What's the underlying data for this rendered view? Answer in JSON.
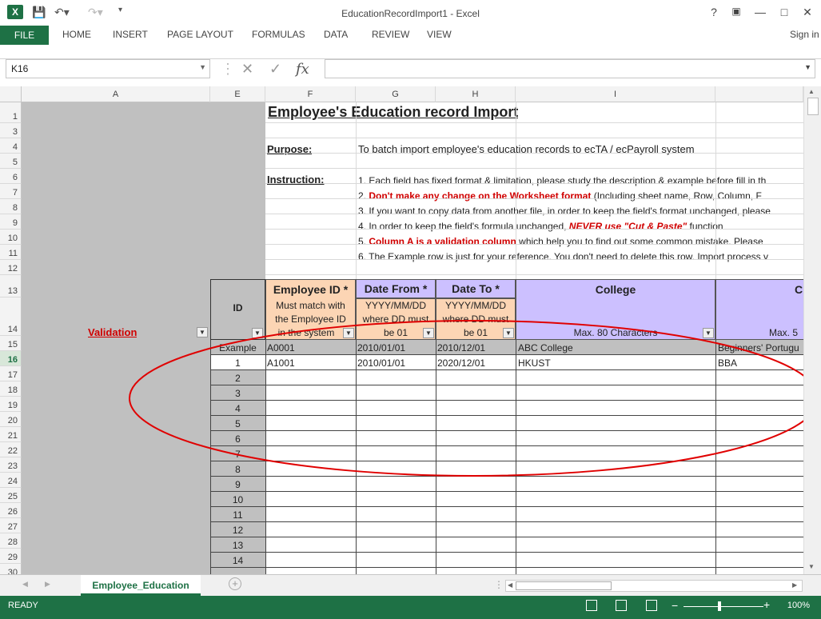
{
  "window": {
    "title": "EducationRecordImport1 - Excel",
    "help": "?",
    "signin": "Sign in"
  },
  "ribbon": {
    "tabs": [
      "FILE",
      "HOME",
      "INSERT",
      "PAGE LAYOUT",
      "FORMULAS",
      "DATA",
      "REVIEW",
      "VIEW"
    ]
  },
  "formula_bar": {
    "name_box": "K16",
    "fx": "fx",
    "formula": ""
  },
  "columns": [
    "A",
    "E",
    "F",
    "G",
    "H",
    "I"
  ],
  "cut_col_letter": "C",
  "rows": [
    "1",
    "3",
    "4",
    "5",
    "6",
    "7",
    "8",
    "9",
    "10",
    "11",
    "12",
    "13",
    "14",
    "15",
    "16",
    "17",
    "18",
    "19",
    "20",
    "21",
    "22",
    "23",
    "24",
    "25",
    "26",
    "27",
    "28",
    "29",
    "30"
  ],
  "active_row": "16",
  "sheet": {
    "title": "Employee's Education record Import",
    "purpose_label": "Purpose:",
    "purpose_text": "To batch import employee's education records to ecTA / ecPayroll system",
    "instruction_label": "Instruction:",
    "instructions": {
      "i1": "1. Each field has fixed format & limitation, please study the description & example before fill in th",
      "i2_num": "2. ",
      "i2_red": "Don't make any change on the Worksheet format",
      "i2_rest": " (Including sheet name, Row, Column, F",
      "i3": "3. If you want to copy data from another file, in order to keep the field's format unchanged, please",
      "i4_pre": "4. In order to keep the field's formula unchanged, ",
      "i4_red": "NEVER use \"Cut & Paste\"",
      "i4_post": " function",
      "i5_num": "5. ",
      "i5_red": "Column A is a validation column",
      "i5_rest": " which help you to find out some common mistake. Please",
      "i6": "6. The Example row is just for your reference. You don't need to delete this row. Import process v"
    },
    "validation_label": "Validation",
    "headers": {
      "id": "ID",
      "employee_id": "Employee ID",
      "employee_id_desc": [
        "Must match with",
        "the Employee ID",
        "in the system"
      ],
      "date_from": "Date From",
      "date_from_desc": [
        "YYYY/MM/DD",
        "where DD must",
        "be 01"
      ],
      "date_to": "Date To",
      "date_to_desc": [
        "YYYY/MM/DD",
        "where DD must",
        "be 01"
      ],
      "college": "College",
      "college_desc": "Max. 80 Characters",
      "cut_desc": "Max. 5",
      "asterisk": "*"
    },
    "example_row": {
      "id": "Example",
      "employee_id": "A0001",
      "date_from": "2010/01/01",
      "date_to": "2010/12/01",
      "college": "ABC College",
      "course": "Beginners' Portugu"
    },
    "data_row": {
      "id": "1",
      "employee_id": "A1001",
      "date_from": "2010/01/01",
      "date_to": "2020/12/01",
      "college": "HKUST",
      "course": "BBA"
    },
    "ids": [
      "2",
      "3",
      "4",
      "5",
      "6",
      "7",
      "8",
      "9",
      "10",
      "11",
      "12",
      "13",
      "14"
    ]
  },
  "sheet_tab": "Employee_Education",
  "status": {
    "ready": "READY",
    "zoom": "100%"
  },
  "colors": {
    "excel_green": "#1e7145",
    "orange_header": "#fcd5b4",
    "purple_header": "#ccc0ff",
    "annotation_red": "#e00000"
  }
}
